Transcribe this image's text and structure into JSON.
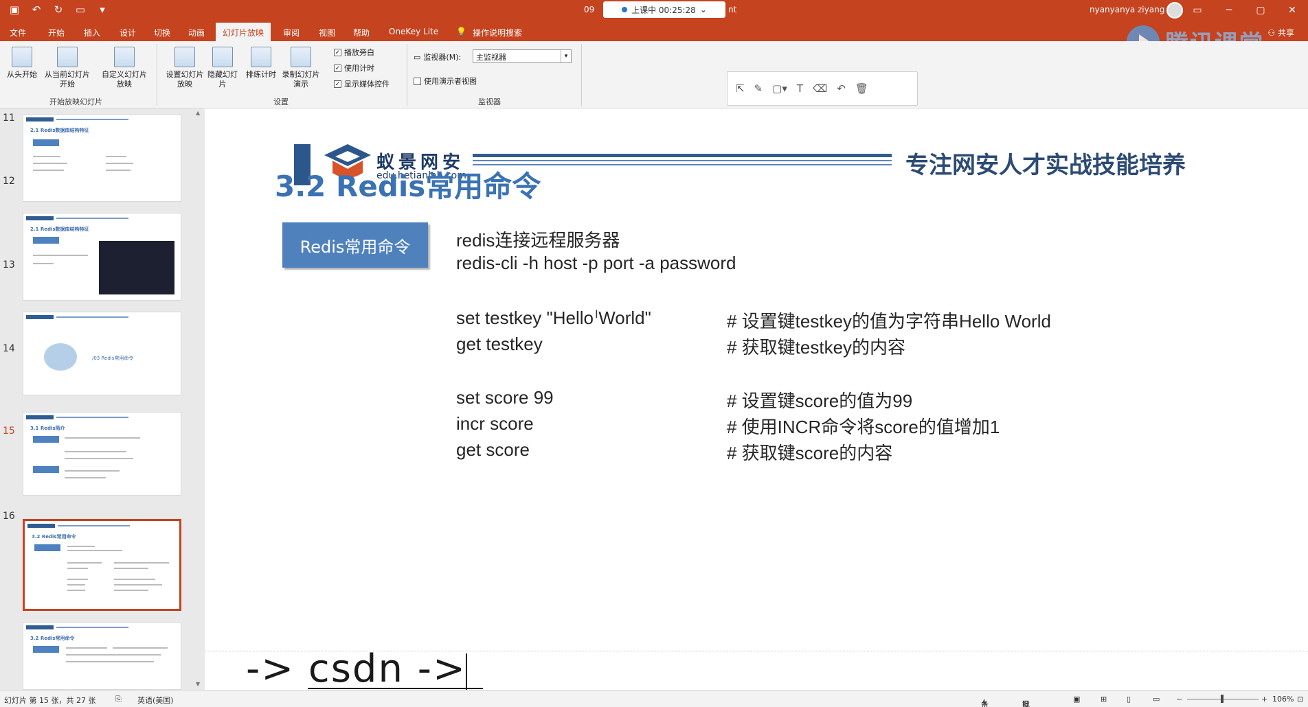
{
  "titlebar": {
    "qat_icons": [
      "save-icon",
      "undo-icon",
      "redo-icon",
      "present-icon",
      "customize-icon"
    ],
    "title_prefix": "09",
    "live_status": "上课中 00:25:28",
    "title_suffix": "nt",
    "user": "nyanyanya ziyang"
  },
  "tabs": [
    "文件",
    "开始",
    "插入",
    "设计",
    "切换",
    "动画",
    "幻灯片放映",
    "审阅",
    "视图",
    "帮助",
    "OneKey Lite",
    "操作说明搜索"
  ],
  "active_tab": "幻灯片放映",
  "share_label": "共享",
  "ribbon": {
    "from_start": "从头开始",
    "from_current": "从当前幻灯片开始",
    "custom_show": "自定义幻灯片放映",
    "group_start": "开始放映幻灯片",
    "setup_show": "设置幻灯片放映",
    "hide_slide": "隐藏幻灯片",
    "rehearse": "排练计时",
    "record": "录制幻灯片演示",
    "chk_narration": "播放旁白",
    "chk_timing": "使用计时",
    "chk_media": "显示媒体控件",
    "group_setup": "设置",
    "monitor_label": "监视器(M):",
    "monitor_value": "主监视器",
    "presenter_view": "使用演示者视图",
    "group_monitor": "监视器"
  },
  "watermark": "腾讯课堂",
  "thumbnails": [
    {
      "num": "11",
      "title": "2.1 Redis数据库结构特征"
    },
    {
      "num": "12",
      "title": "2.1 Redis数据库结构特征"
    },
    {
      "num": "13",
      "title": "/03 Redis常用命令"
    },
    {
      "num": "14",
      "title": "3.1 Redis简介"
    },
    {
      "num": "15",
      "title": "3.2 Redis常用命令"
    },
    {
      "num": "16",
      "title": "3.2 Redis常用命令"
    }
  ],
  "slide": {
    "brand_cn": "蚁景网安",
    "brand_url": "edu.hetianlab.com",
    "slogan": "专注网安人才实战技能培养",
    "title": "3.2 Redis常用命令",
    "button": "Redis常用命令",
    "lines": [
      "redis连接远程服务器",
      "redis-cli -h host -p port -a password",
      "set testkey \"Hello World\"",
      "get testkey",
      "set score 99",
      "incr score",
      "get score"
    ],
    "comments": [
      "# 设置键testkey的值为字符串Hello World",
      "# 获取键testkey的内容",
      "# 设置键score的值为99",
      "# 使用INCR命令将score的值增加1",
      "# 获取键score的内容"
    ]
  },
  "overlay_text": "-> csdn ->",
  "status": {
    "slide_info": "幻灯片 第 15 张，共 27 张",
    "language": "英语(美国)",
    "notes": "备注",
    "comments": "批注",
    "zoom": "106%"
  },
  "colors": {
    "accent": "#c5431f",
    "slide_blue": "#4f81bd",
    "title_blue": "#3a72b4"
  }
}
